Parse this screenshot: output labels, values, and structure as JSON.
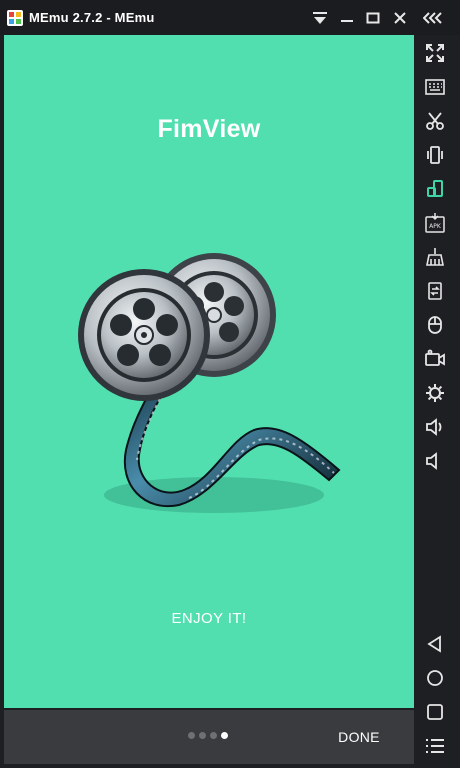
{
  "window": {
    "title": "MEmu 2.7.2 - MEmu",
    "logo_icon": "memu-logo-icon",
    "controls": [
      "dropdown-icon",
      "minimize-icon",
      "maximize-icon",
      "close-icon",
      "collapse-sidebar-icon"
    ]
  },
  "app": {
    "name": "FimView",
    "caption": "ENJOY IT!",
    "illustration": "film-reel-icon",
    "background_color": "#52dfb0"
  },
  "onboarding": {
    "pages": 4,
    "active_page": 4,
    "done_label": "DONE"
  },
  "sidebar": {
    "items": [
      {
        "icon": "fullscreen-icon"
      },
      {
        "icon": "keyboard-icon"
      },
      {
        "icon": "screenshot-scissors-icon"
      },
      {
        "icon": "shake-icon"
      },
      {
        "icon": "rotate-icon",
        "accent": "#3ed4a6"
      },
      {
        "icon": "install-apk-icon"
      },
      {
        "icon": "cleanup-icon"
      },
      {
        "icon": "sync-file-icon"
      },
      {
        "icon": "mouse-icon"
      },
      {
        "icon": "record-video-icon"
      },
      {
        "icon": "settings-gear-icon"
      },
      {
        "icon": "volume-up-icon"
      },
      {
        "icon": "volume-down-icon"
      }
    ],
    "nav": [
      {
        "icon": "back-icon"
      },
      {
        "icon": "home-icon"
      },
      {
        "icon": "recents-icon"
      },
      {
        "icon": "menu-icon"
      }
    ]
  }
}
